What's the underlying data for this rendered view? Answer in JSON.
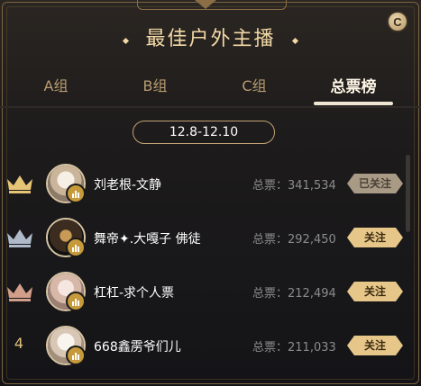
{
  "header": {
    "title": "最佳户外主播",
    "refresh_glyph": "C"
  },
  "tabs": [
    {
      "label": "A组"
    },
    {
      "label": "B组"
    },
    {
      "label": "C组"
    },
    {
      "label": "总票榜"
    }
  ],
  "active_tab": "总票榜",
  "date_range": "12.8-12.10",
  "rows": [
    {
      "rank": "1",
      "rank_icon": "gold-crown-icon",
      "name": "刘老根-文静",
      "votes": "总票：341,534",
      "follow": "已关注",
      "followed": true
    },
    {
      "rank": "2",
      "rank_icon": "silver-crown-icon",
      "name": "舞帝✦.大嘎子 佛徒",
      "votes": "总票：292,450",
      "follow": "关注",
      "followed": false
    },
    {
      "rank": "3",
      "rank_icon": "bronze-crown-icon",
      "name": "杠杠-求个人票",
      "votes": "总票：212,494",
      "follow": "关注",
      "followed": false
    },
    {
      "rank": "4",
      "rank_icon": "",
      "name": "668鑫雳爷们儿",
      "votes": "总票：211,033",
      "follow": "关注",
      "followed": false
    }
  ],
  "colors": {
    "gold": "#e6c689",
    "accent_text": "#f3d9a6",
    "followed_bg": "#a99a86"
  }
}
